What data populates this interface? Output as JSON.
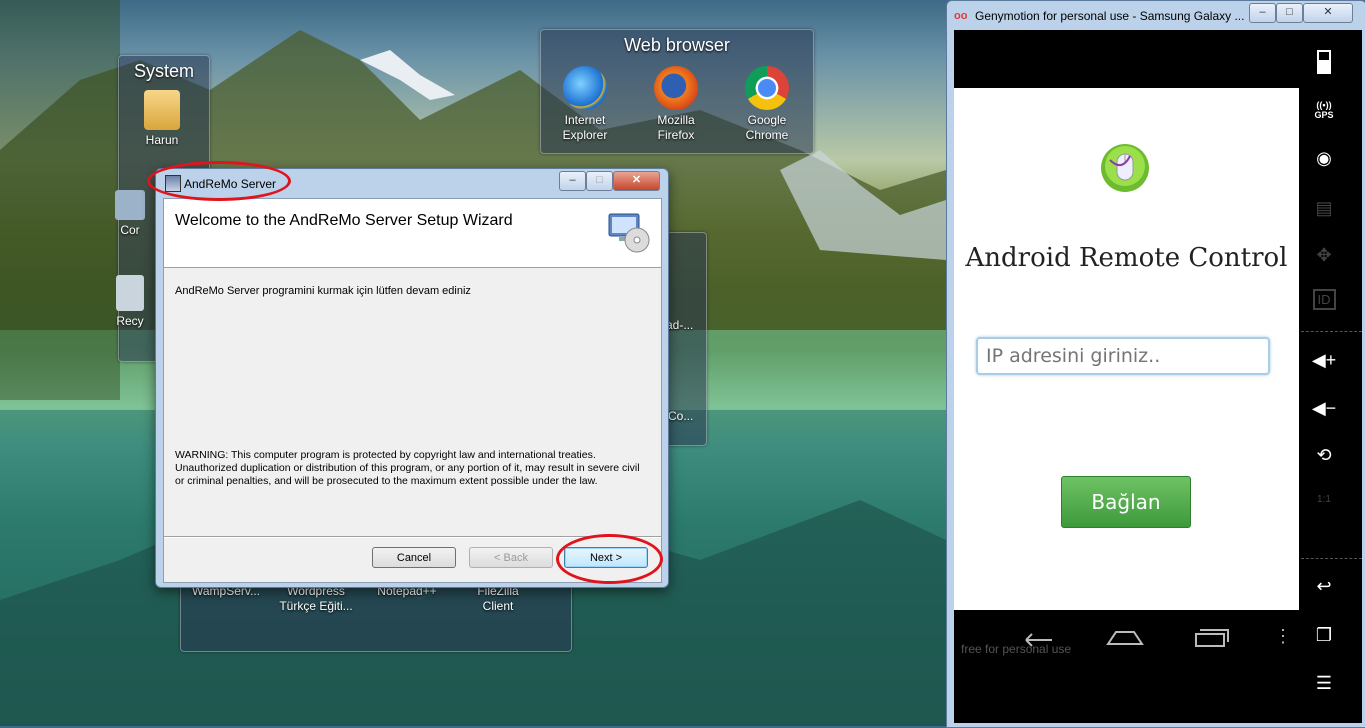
{
  "desktop": {
    "system_gadget": {
      "title": "System",
      "icons": [
        {
          "label": "Harun",
          "icon": "user-folder-icon"
        },
        {
          "label": "Cor",
          "icon": "computer-icon"
        },
        {
          "label": "Recy",
          "icon": "recycle-bin-icon"
        }
      ]
    },
    "browser_gadget": {
      "title": "Web browser",
      "icons": [
        {
          "label": "Internet Explorer",
          "line1": "Internet",
          "line2": "Explorer",
          "icon": "internet-explorer-icon"
        },
        {
          "label": "Mozilla Firefox",
          "line1": "Mozilla",
          "line2": "Firefox",
          "icon": "firefox-icon"
        },
        {
          "label": "Google Chrome",
          "line1": "Google",
          "line2": "Chrome",
          "icon": "chrome-icon"
        }
      ]
    },
    "bottom_gadget": {
      "icons": [
        {
          "line1": "WampServ...",
          "line2": ""
        },
        {
          "line1": "Wordpress",
          "line2": "Türkçe Eğiti..."
        },
        {
          "line1": "Notepad++",
          "line2": ""
        },
        {
          "line1": "FileZilla",
          "line2": "Client"
        }
      ]
    },
    "hidden_gadget": {
      "labels": [
        "ad-...",
        "Co..."
      ]
    }
  },
  "installer": {
    "window_title": "AndReMo Server",
    "header_title": "Welcome to the AndReMo Server Setup Wizard",
    "body_text": "AndReMo Server programini kurmak için lütfen devam ediniz",
    "warning": "WARNING: This computer program is protected by copyright law and international treaties. Unauthorized duplication or distribution of this program, or any portion of it, may result in severe civil or criminal penalties, and will be prosecuted to the maximum extent possible under the law.",
    "buttons": {
      "cancel": "Cancel",
      "back": "< Back",
      "next": "Next >"
    },
    "window_controls": {
      "minimize": "–",
      "maximize": "□",
      "close": "✕"
    }
  },
  "genymotion": {
    "window_title": "Genymotion for personal use - Samsung Galaxy ...",
    "logo": "oo",
    "window_controls": {
      "minimize": "–",
      "maximize": "□",
      "close": "✕"
    },
    "app": {
      "title": "Android Remote Control",
      "ip_placeholder": "IP adresini giriniz..",
      "connect_label": "Bağlan"
    },
    "watermark": "free for personal use",
    "side_panel": [
      {
        "icon": "battery-icon",
        "label": ""
      },
      {
        "icon": "gps-icon",
        "label": "GPS"
      },
      {
        "icon": "webcam-icon",
        "label": ""
      },
      {
        "icon": "video-capture-icon",
        "label": ""
      },
      {
        "icon": "dpad-icon",
        "label": ""
      },
      {
        "icon": "id-icon",
        "label": "ID"
      },
      {
        "icon": "volume-up-icon",
        "label": ""
      },
      {
        "icon": "volume-down-icon",
        "label": ""
      },
      {
        "icon": "rotate-icon",
        "label": ""
      },
      {
        "icon": "scale-icon",
        "label": "1:1"
      },
      {
        "icon": "back-icon",
        "label": ""
      },
      {
        "icon": "recent-apps-icon",
        "label": ""
      },
      {
        "icon": "menu-icon",
        "label": ""
      }
    ]
  },
  "colors": {
    "highlight_ellipse": "#e0141c",
    "connect_button": "#4caf50"
  }
}
